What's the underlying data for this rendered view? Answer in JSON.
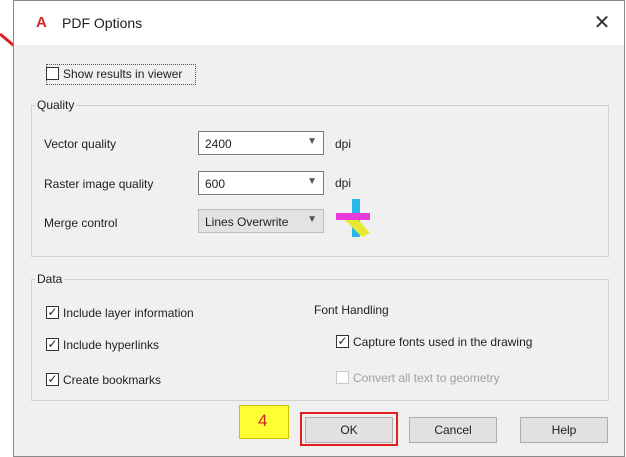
{
  "window": {
    "title": "PDF Options",
    "close_label": "✕"
  },
  "show_results": {
    "label": "Show results in viewer",
    "checked": false
  },
  "quality": {
    "legend": "Quality",
    "vector": {
      "label": "Vector quality",
      "value": "2400",
      "unit": "dpi"
    },
    "raster": {
      "label": "Raster image quality",
      "value": "600",
      "unit": "dpi"
    },
    "merge": {
      "label": "Merge control",
      "value": "Lines Overwrite"
    }
  },
  "data_group": {
    "legend": "Data",
    "include_layer": {
      "label": "Include layer information",
      "checked": true
    },
    "include_hyperlinks": {
      "label": "Include hyperlinks",
      "checked": true
    },
    "create_bookmarks": {
      "label": "Create bookmarks",
      "checked": true
    },
    "font_handling": {
      "heading": "Font Handling",
      "capture_fonts": {
        "label": "Capture fonts used in the drawing",
        "checked": true
      },
      "convert_text": {
        "label": "Convert all text to geometry",
        "checked": false
      }
    }
  },
  "buttons": {
    "ok": "OK",
    "cancel": "Cancel",
    "help": "Help"
  },
  "annotation": {
    "step_number": "4"
  },
  "colors": {
    "step_badge": "#ffff33",
    "highlight": "#e02020",
    "arrow": "#e02020",
    "app_icon": "#d42a2a"
  },
  "icons": {
    "app": "autocad-a-icon",
    "merge_preview": "merge-lines-preview-icon",
    "dropdown": "chevron-down-icon"
  }
}
